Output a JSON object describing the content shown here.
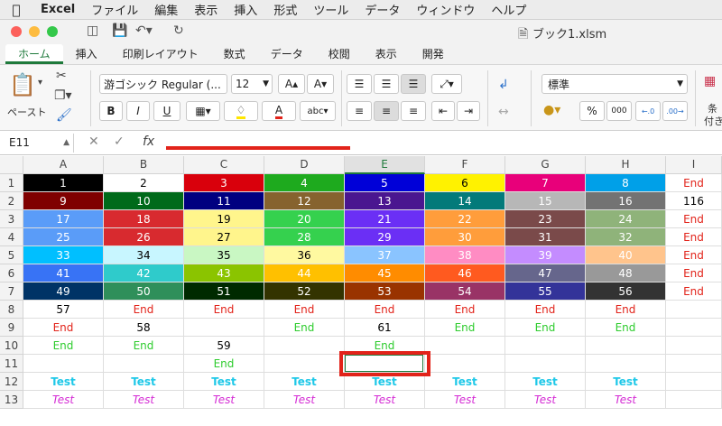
{
  "menubar": {
    "app": "Excel",
    "items": [
      "ファイル",
      "編集",
      "表示",
      "挿入",
      "形式",
      "ツール",
      "データ",
      "ウィンドウ",
      "ヘルプ"
    ]
  },
  "window": {
    "title": "ブック1.xlsm"
  },
  "ribbon_tabs": [
    "ホーム",
    "挿入",
    "印刷レイアウト",
    "数式",
    "データ",
    "校閲",
    "表示",
    "開発"
  ],
  "ribbon": {
    "paste_label": "ペースト",
    "font_name": "游ゴシック Regular (...",
    "font_size": "12",
    "bold": "B",
    "italic": "I",
    "underline": "U",
    "number_format": "標準",
    "percent": "%",
    "comma": "000",
    "conditional_partial": "条",
    "conditional_partial2": "付き"
  },
  "formula_bar": {
    "name_box": "E11",
    "fx": "fx",
    "formula": ""
  },
  "sheet": {
    "columns": [
      "A",
      "B",
      "C",
      "D",
      "E",
      "F",
      "G",
      "H",
      "I"
    ],
    "selected_column": "E",
    "rows": [
      "1",
      "2",
      "3",
      "4",
      "5",
      "6",
      "7",
      "8",
      "9",
      "10",
      "11",
      "12",
      "13"
    ],
    "selected_cell": "E11",
    "cells": [
      [
        [
          "1",
          "#000000",
          "#ffffff",
          ""
        ],
        [
          "2",
          "#ffffff",
          "#000000",
          ""
        ],
        [
          "3",
          "#d9000c",
          "#ffffff",
          ""
        ],
        [
          "4",
          "#1eaa1e",
          "#ffffff",
          ""
        ],
        [
          "5",
          "#0000d8",
          "#ffffff",
          ""
        ],
        [
          "6",
          "#fff200",
          "#000000",
          ""
        ],
        [
          "7",
          "#e8007a",
          "#ffffff",
          ""
        ],
        [
          "8",
          "#00a0e8",
          "#ffffff",
          ""
        ],
        [
          "End",
          "#ffffff",
          "#e2231a",
          ""
        ]
      ],
      [
        [
          "9",
          "#7f0000",
          "#ffffff",
          ""
        ],
        [
          "10",
          "#006a1a",
          "#ffffff",
          ""
        ],
        [
          "11",
          "#000080",
          "#ffffff",
          ""
        ],
        [
          "12",
          "#86632e",
          "#ffffff",
          ""
        ],
        [
          "13",
          "#4a1690",
          "#ffffff",
          ""
        ],
        [
          "14",
          "#037a7a",
          "#ffffff",
          ""
        ],
        [
          "15",
          "#b7b7b7",
          "#ffffff",
          ""
        ],
        [
          "16",
          "#737373",
          "#ffffff",
          ""
        ],
        [
          "116",
          "#ffffff",
          "#000000",
          ""
        ]
      ],
      [
        [
          "17",
          "#5a9cf8",
          "#ffffff",
          ""
        ],
        [
          "18",
          "#d82a2f",
          "#ffffff",
          ""
        ],
        [
          "19",
          "#fff58c",
          "#000000",
          ""
        ],
        [
          "20",
          "#35d14e",
          "#ffffff",
          ""
        ],
        [
          "21",
          "#6b2ff5",
          "#ffffff",
          ""
        ],
        [
          "22",
          "#ff9d3b",
          "#ffffff",
          ""
        ],
        [
          "23",
          "#7a4a4a",
          "#ffffff",
          ""
        ],
        [
          "24",
          "#8fb37a",
          "#ffffff",
          ""
        ],
        [
          "End",
          "#ffffff",
          "#e2231a",
          ""
        ]
      ],
      [
        [
          "25",
          "#5a9cf8",
          "#ffffff",
          ""
        ],
        [
          "26",
          "#d82a2f",
          "#ffffff",
          ""
        ],
        [
          "27",
          "#fff58c",
          "#000000",
          ""
        ],
        [
          "28",
          "#35d14e",
          "#ffffff",
          ""
        ],
        [
          "29",
          "#6b2ff5",
          "#ffffff",
          ""
        ],
        [
          "30",
          "#ff9d3b",
          "#ffffff",
          ""
        ],
        [
          "31",
          "#7a4a4a",
          "#ffffff",
          ""
        ],
        [
          "32",
          "#8fb37a",
          "#ffffff",
          ""
        ],
        [
          "End",
          "#ffffff",
          "#e2231a",
          ""
        ]
      ],
      [
        [
          "33",
          "#00bfff",
          "#ffffff",
          ""
        ],
        [
          "34",
          "#c8f6ff",
          "#000000",
          ""
        ],
        [
          "35",
          "#c9f7c3",
          "#000000",
          ""
        ],
        [
          "36",
          "#fff9a0",
          "#000000",
          ""
        ],
        [
          "37",
          "#8ac4ff",
          "#ffffff",
          ""
        ],
        [
          "38",
          "#ff8cc3",
          "#ffffff",
          ""
        ],
        [
          "39",
          "#c48cff",
          "#ffffff",
          ""
        ],
        [
          "40",
          "#ffc48c",
          "#ffffff",
          ""
        ],
        [
          "End",
          "#ffffff",
          "#e2231a",
          ""
        ]
      ],
      [
        [
          "41",
          "#3873f5",
          "#ffffff",
          ""
        ],
        [
          "42",
          "#2fcbcb",
          "#ffffff",
          ""
        ],
        [
          "43",
          "#8bc400",
          "#ffffff",
          ""
        ],
        [
          "44",
          "#ffc000",
          "#ffffff",
          ""
        ],
        [
          "45",
          "#ff8c00",
          "#ffffff",
          ""
        ],
        [
          "46",
          "#ff5a1f",
          "#ffffff",
          ""
        ],
        [
          "47",
          "#66668c",
          "#ffffff",
          ""
        ],
        [
          "48",
          "#999999",
          "#ffffff",
          ""
        ],
        [
          "End",
          "#ffffff",
          "#e2231a",
          ""
        ]
      ],
      [
        [
          "49",
          "#003366",
          "#ffffff",
          ""
        ],
        [
          "50",
          "#2f8f5a",
          "#ffffff",
          ""
        ],
        [
          "51",
          "#002a00",
          "#ffffff",
          ""
        ],
        [
          "52",
          "#333300",
          "#ffffff",
          ""
        ],
        [
          "53",
          "#993300",
          "#ffffff",
          ""
        ],
        [
          "54",
          "#993366",
          "#ffffff",
          ""
        ],
        [
          "55",
          "#333399",
          "#ffffff",
          ""
        ],
        [
          "56",
          "#333333",
          "#ffffff",
          ""
        ],
        [
          "End",
          "#ffffff",
          "#e2231a",
          ""
        ]
      ],
      [
        [
          "57",
          "#ffffff",
          "#000000",
          ""
        ],
        [
          "End",
          "#ffffff",
          "#e2231a",
          ""
        ],
        [
          "End",
          "#ffffff",
          "#e2231a",
          ""
        ],
        [
          "End",
          "#ffffff",
          "#e2231a",
          ""
        ],
        [
          "End",
          "#ffffff",
          "#e2231a",
          ""
        ],
        [
          "End",
          "#ffffff",
          "#e2231a",
          ""
        ],
        [
          "End",
          "#ffffff",
          "#e2231a",
          ""
        ],
        [
          "End",
          "#ffffff",
          "#e2231a",
          ""
        ],
        [
          "",
          "#ffffff",
          "#000000",
          ""
        ]
      ],
      [
        [
          "End",
          "#ffffff",
          "#e2231a",
          ""
        ],
        [
          "58",
          "#ffffff",
          "#000000",
          ""
        ],
        [
          "",
          "#ffffff",
          "#000000",
          ""
        ],
        [
          "End",
          "#ffffff",
          "#2ecc2e",
          ""
        ],
        [
          "61",
          "#ffffff",
          "#000000",
          ""
        ],
        [
          "End",
          "#ffffff",
          "#2ecc2e",
          ""
        ],
        [
          "End",
          "#ffffff",
          "#2ecc2e",
          ""
        ],
        [
          "End",
          "#ffffff",
          "#2ecc2e",
          ""
        ],
        [
          "",
          "#ffffff",
          "#000000",
          ""
        ]
      ],
      [
        [
          "End",
          "#ffffff",
          "#2ecc2e",
          ""
        ],
        [
          "End",
          "#ffffff",
          "#2ecc2e",
          ""
        ],
        [
          "59",
          "#ffffff",
          "#000000",
          ""
        ],
        [
          "",
          "#ffffff",
          "#000000",
          ""
        ],
        [
          "End",
          "#ffffff",
          "#2ecc2e",
          ""
        ],
        [
          "",
          "#ffffff",
          "#000000",
          ""
        ],
        [
          "",
          "#ffffff",
          "#000000",
          ""
        ],
        [
          "",
          "#ffffff",
          "#000000",
          ""
        ],
        [
          "",
          "#ffffff",
          "#000000",
          ""
        ]
      ],
      [
        [
          "",
          "#ffffff",
          "#000000",
          ""
        ],
        [
          "",
          "#ffffff",
          "#000000",
          ""
        ],
        [
          "End",
          "#ffffff",
          "#2ecc2e",
          ""
        ],
        [
          "",
          "#ffffff",
          "#000000",
          ""
        ],
        [
          "",
          "#ffffff",
          "#000000",
          ""
        ],
        [
          "",
          "#ffffff",
          "#000000",
          ""
        ],
        [
          "",
          "#ffffff",
          "#000000",
          ""
        ],
        [
          "",
          "#ffffff",
          "#000000",
          ""
        ],
        [
          "",
          "#ffffff",
          "#000000",
          ""
        ]
      ],
      [
        [
          "Test",
          "#ffffff",
          "#1ec8e8",
          "bold"
        ],
        [
          "Test",
          "#ffffff",
          "#1ec8e8",
          "bold"
        ],
        [
          "Test",
          "#ffffff",
          "#1ec8e8",
          "bold"
        ],
        [
          "Test",
          "#ffffff",
          "#1ec8e8",
          "bold"
        ],
        [
          "Test",
          "#ffffff",
          "#1ec8e8",
          "bold"
        ],
        [
          "Test",
          "#ffffff",
          "#1ec8e8",
          "bold"
        ],
        [
          "Test",
          "#ffffff",
          "#1ec8e8",
          "bold"
        ],
        [
          "Test",
          "#ffffff",
          "#1ec8e8",
          "bold"
        ],
        [
          "",
          "#ffffff",
          "#000000",
          ""
        ]
      ],
      [
        [
          "Test",
          "#ffffff",
          "#d42ad4",
          "italic"
        ],
        [
          "Test",
          "#ffffff",
          "#d42ad4",
          "italic"
        ],
        [
          "Test",
          "#ffffff",
          "#d42ad4",
          "italic"
        ],
        [
          "Test",
          "#ffffff",
          "#d42ad4",
          "italic"
        ],
        [
          "Test",
          "#ffffff",
          "#d42ad4",
          "italic"
        ],
        [
          "Test",
          "#ffffff",
          "#d42ad4",
          "italic"
        ],
        [
          "Test",
          "#ffffff",
          "#d42ad4",
          "italic"
        ],
        [
          "Test",
          "#ffffff",
          "#d42ad4",
          "italic"
        ],
        [
          "",
          "#ffffff",
          "#000000",
          ""
        ]
      ]
    ]
  }
}
